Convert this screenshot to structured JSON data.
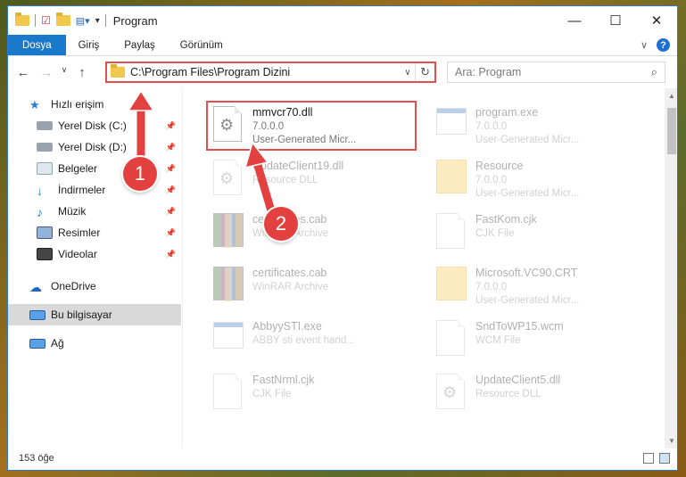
{
  "window": {
    "title": "Program",
    "controls": {
      "minimize": "—",
      "maximize": "☐",
      "close": "✕"
    }
  },
  "ribbon": {
    "tabs": [
      {
        "label": "Dosya",
        "active": true
      },
      {
        "label": "Giriş"
      },
      {
        "label": "Paylaş"
      },
      {
        "label": "Görünüm"
      }
    ],
    "help": "?"
  },
  "nav": {
    "address": "C:\\Program Files\\Program Dizini",
    "search_placeholder": "Ara: Program"
  },
  "sidebar": {
    "items": [
      {
        "label": "Hızlı erişim",
        "icon": "star-icon",
        "pinned": false
      },
      {
        "label": "Yerel Disk (C:)",
        "icon": "drive-icon",
        "pinned": true
      },
      {
        "label": "Yerel Disk (D:)",
        "icon": "drive-icon",
        "pinned": true
      },
      {
        "label": "Belgeler",
        "icon": "documents-icon",
        "pinned": true
      },
      {
        "label": "İndirmeler",
        "icon": "download-icon",
        "pinned": true
      },
      {
        "label": "Müzik",
        "icon": "music-icon",
        "pinned": true
      },
      {
        "label": "Resimler",
        "icon": "pictures-icon",
        "pinned": true
      },
      {
        "label": "Videolar",
        "icon": "video-icon",
        "pinned": true
      },
      {
        "label": "OneDrive",
        "icon": "cloud-icon",
        "pinned": false
      },
      {
        "label": "Bu bilgisayar",
        "icon": "computer-icon",
        "pinned": false,
        "selected": true
      },
      {
        "label": "Ağ",
        "icon": "network-icon",
        "pinned": false
      }
    ]
  },
  "files": [
    {
      "name": "mmvcr70.dll",
      "line1": "7.0.0.0",
      "line2": "User-Generated Micr...",
      "icon": "dll-gear-icon",
      "faded": false,
      "highlighted": true
    },
    {
      "name": "program.exe",
      "line1": "7.0.0.0",
      "line2": "User-Generated Micr...",
      "icon": "exe-icon",
      "faded": true
    },
    {
      "name": "UpdateClient19.dll",
      "line1": "Resource DLL",
      "line2": "",
      "icon": "dll-gear-icon",
      "faded": true
    },
    {
      "name": "Resource",
      "line1": "7.0.0.0",
      "line2": "User-Generated Micr...",
      "icon": "folder-icon",
      "faded": true
    },
    {
      "name": "certificates.cab",
      "line1": "WinRAR Archive",
      "line2": "",
      "icon": "rar-icon",
      "faded": true
    },
    {
      "name": "FastKom.cjk",
      "line1": "CJK File",
      "line2": "",
      "icon": "blank-doc-icon",
      "faded": true
    },
    {
      "name": "certificates.cab",
      "line1": "WinRAR Archive",
      "line2": "",
      "icon": "rar-icon",
      "faded": true
    },
    {
      "name": "Microsoft.VC90.CRT",
      "line1": "7.0.0.0",
      "line2": "User-Generated Micr...",
      "icon": "folder-icon",
      "faded": true
    },
    {
      "name": "AbbyySTI.exe",
      "line1": "ABBY sti event hand...",
      "line2": "",
      "icon": "exe-icon",
      "faded": true
    },
    {
      "name": "SndToWP15.wcm",
      "line1": "WCM File",
      "line2": "",
      "icon": "blank-doc-icon",
      "faded": true
    },
    {
      "name": "FastNrml.cjk",
      "line1": "CJK File",
      "line2": "",
      "icon": "blank-doc-icon",
      "faded": true
    },
    {
      "name": "UpdateClient5.dll",
      "line1": "Resource DLL",
      "line2": "",
      "icon": "dll-gear-icon",
      "faded": true
    }
  ],
  "status": {
    "count": "153 öğe"
  },
  "annotations": {
    "badge1": "1",
    "badge2": "2",
    "color": "#e3413f"
  }
}
